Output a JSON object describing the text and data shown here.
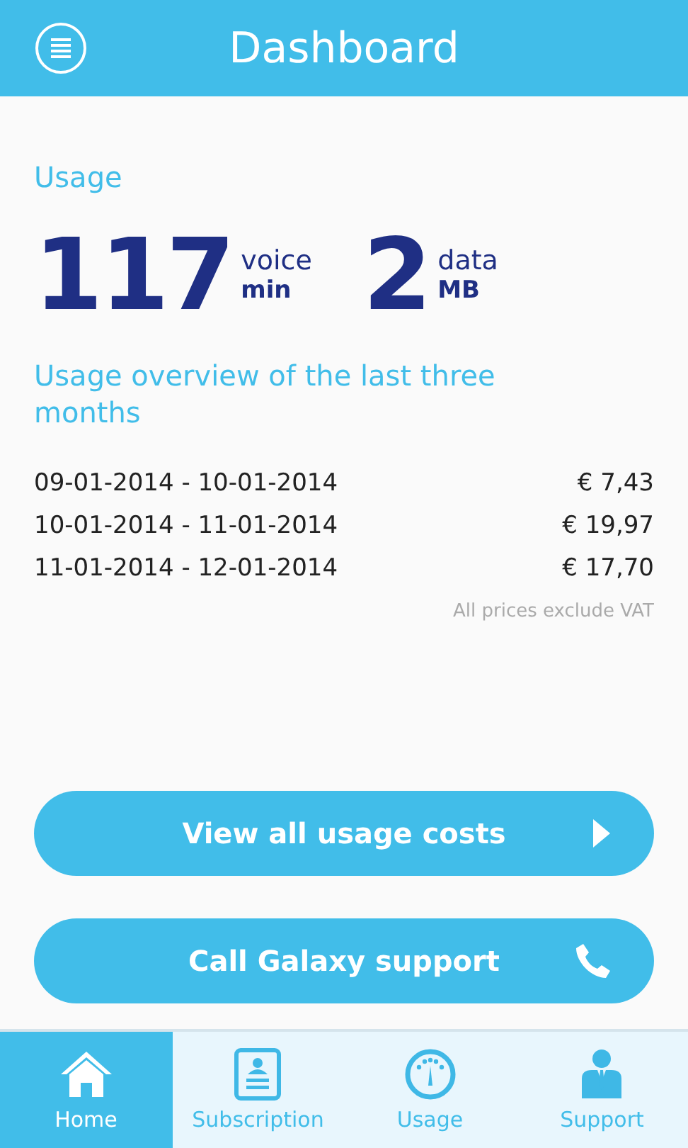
{
  "header": {
    "title": "Dashboard"
  },
  "usage": {
    "title": "Usage",
    "stats": [
      {
        "value": "117",
        "label": "voice",
        "unit": "min"
      },
      {
        "value": "2",
        "label": "data",
        "unit": "MB"
      }
    ]
  },
  "overview": {
    "title": "Usage overview of the last three months",
    "rows": [
      {
        "period": "09-01-2014 - 10-01-2014",
        "amount": "€ 7,43"
      },
      {
        "period": "10-01-2014 - 11-01-2014",
        "amount": "€ 19,97"
      },
      {
        "period": "11-01-2014 - 12-01-2014",
        "amount": "€ 17,70"
      }
    ],
    "note": "All prices exclude VAT"
  },
  "buttons": [
    {
      "label": "View all usage costs",
      "kind": "arrow"
    },
    {
      "label": "Call Galaxy support",
      "kind": "phone"
    }
  ],
  "tabs": [
    {
      "label": "Home",
      "kind": "home",
      "selected": true
    },
    {
      "label": "Subscription",
      "kind": "subscription",
      "selected": false
    },
    {
      "label": "Usage",
      "kind": "usage",
      "selected": false
    },
    {
      "label": "Support",
      "kind": "support",
      "selected": false
    }
  ]
}
